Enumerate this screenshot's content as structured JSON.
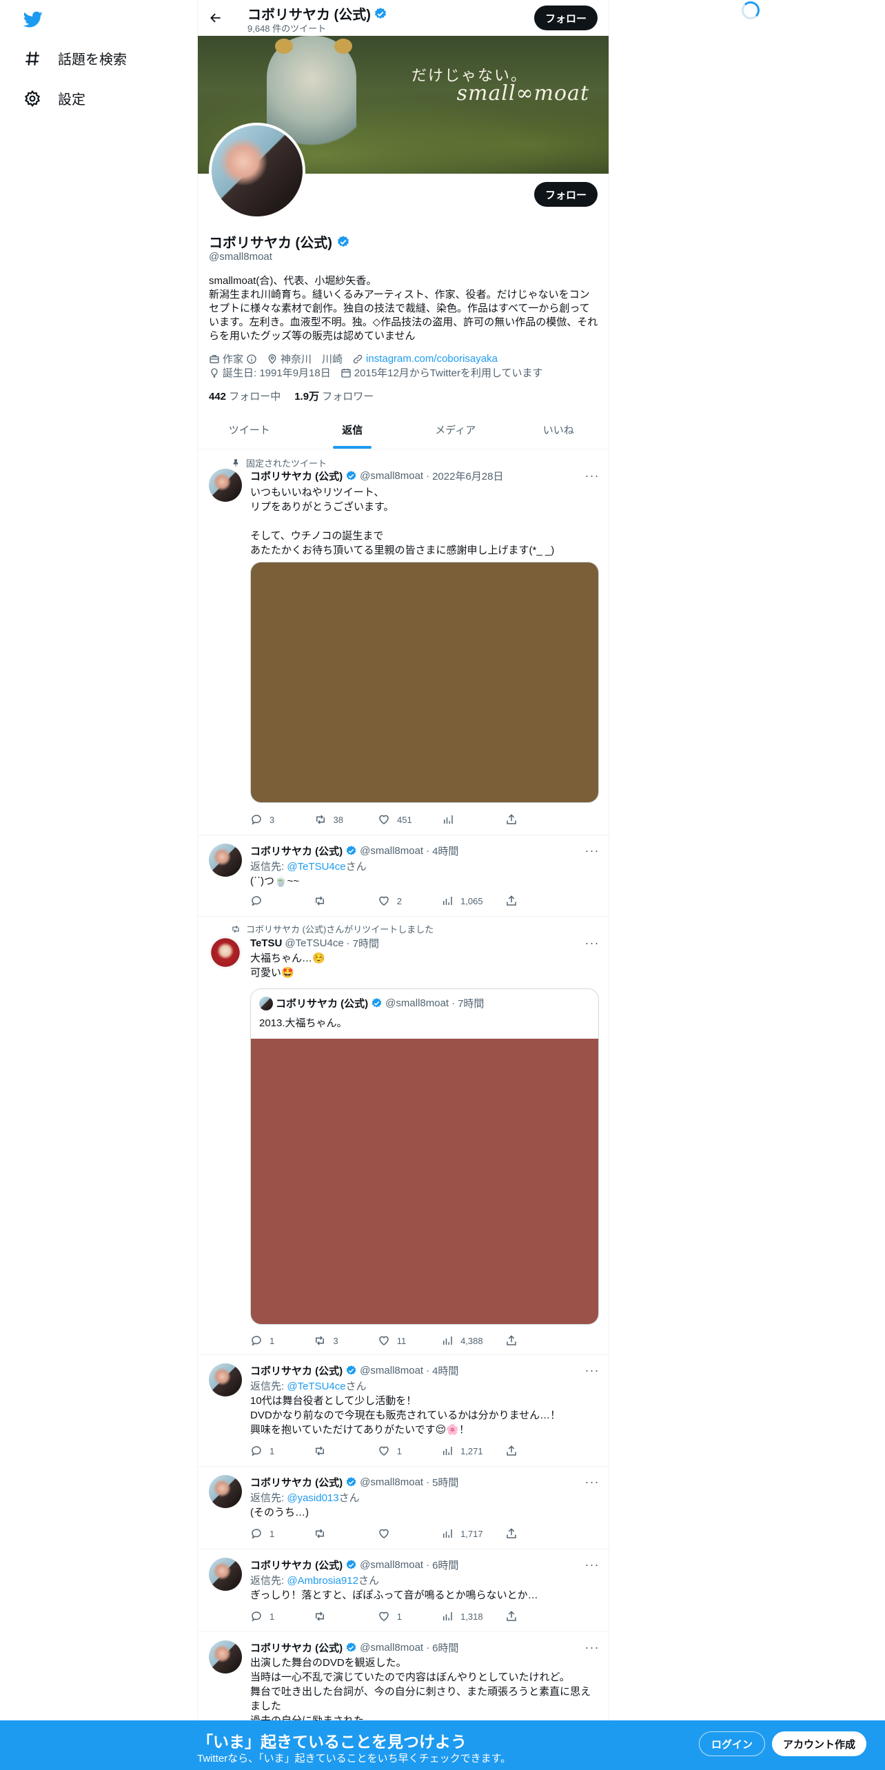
{
  "nav": {
    "explore_label": "話題を検索",
    "settings_label": "設定"
  },
  "header": {
    "name": "コボリサヤカ (公式)",
    "tweet_count": "9,648 件のツイート",
    "follow_label": "フォロー"
  },
  "banner": {
    "tagline": "だけじゃない。",
    "brand": "small∞moat"
  },
  "profile": {
    "name": "コボリサヤカ (公式)",
    "handle": "@small8moat",
    "follow_label": "フォロー",
    "bio": "smallmoat(合)、代表、小堀紗矢香。\n新潟生まれ川崎育ち。縫いくるみアーティスト、作家、役者。だけじゃないをコンセプトに様々な素材で創作。独自の技法で裁縫、染色。作品はすべて一から創っています。左利き。血液型不明。独。◇作品技法の盗用、許可の無い作品の模倣、それらを用いたグッズ等の販売は認めていません",
    "category": "作家",
    "location": "神奈川　川崎",
    "website": "instagram.com/coborisayaka",
    "birthday": "誕生日: 1991年9月18日",
    "joined": "2015年12月からTwitterを利用しています",
    "following_count": "442",
    "following_label": "フォロー中",
    "followers_count": "1.9万",
    "followers_label": "フォロワー"
  },
  "tabs": [
    "ツイート",
    "返信",
    "メディア",
    "いいね"
  ],
  "active_tab": "返信",
  "colors": {
    "accent": "#1d9bf0",
    "media1": "#7a5f38",
    "media2": "#9a5249"
  },
  "tweets": [
    {
      "context": "固定されたツイート",
      "name": "コボリサヤカ (公式)",
      "handle": "@small8moat",
      "time": "2022年6月28日",
      "text": "いつもいいねやリツイート、\nリプをありがとうございます。\n\nそして、ウチノコの誕生まで\nあたたかくお待ち頂いてる里親の皆さまに感謝申し上げます(*_ _)",
      "reply": "3",
      "retweet": "38",
      "like": "451",
      "views": ""
    },
    {
      "name": "コボリサヤカ (公式)",
      "handle": "@small8moat",
      "time": "4時間",
      "reply_prefix": "返信先: ",
      "reply_to": "@TeTSU4ce",
      "reply_suffix": "さん",
      "text": "(ˊˋ)つ🍵~~",
      "reply": "",
      "retweet": "",
      "like": "2",
      "views": "1,065"
    },
    {
      "context": "コボリサヤカ (公式)さんがリツイートしました",
      "name": "TeTSU",
      "handle": "@TeTSU4ce",
      "time": "7時間",
      "text": "大福ちゃん…☺️\n可愛い🤩",
      "quote_name": "コボリサヤカ (公式)",
      "quote_handle": "@small8moat",
      "quote_time": "7時間",
      "quote_text": "2013.大福ちゃん。",
      "reply": "1",
      "retweet": "3",
      "like": "11",
      "views": "4,388"
    },
    {
      "name": "コボリサヤカ (公式)",
      "handle": "@small8moat",
      "time": "4時間",
      "reply_prefix": "返信先: ",
      "reply_to": "@TeTSU4ce",
      "reply_suffix": "さん",
      "text": "10代は舞台役者として少し活動を！\nDVDかなり前なので今現在も販売されているかは分かりません…！\n興味を抱いていただけてありがたいです😌🌸！",
      "reply": "1",
      "retweet": "",
      "like": "1",
      "views": "1,271"
    },
    {
      "name": "コボリサヤカ (公式)",
      "handle": "@small8moat",
      "time": "5時間",
      "reply_prefix": "返信先: ",
      "reply_to": "@yasid013",
      "reply_suffix": "さん",
      "text": "(そのうち…)",
      "reply": "1",
      "retweet": "",
      "like": "",
      "views": "1,717"
    },
    {
      "name": "コボリサヤカ (公式)",
      "handle": "@small8moat",
      "time": "6時間",
      "reply_prefix": "返信先: ",
      "reply_to": "@Ambrosia912",
      "reply_suffix": "さん",
      "text": "ぎっしり！落とすと、ぽぽふって音が鳴るとか鳴らないとか…",
      "reply": "1",
      "retweet": "",
      "like": "1",
      "views": "1,318"
    },
    {
      "name": "コボリサヤカ (公式)",
      "handle": "@small8moat",
      "time": "6時間",
      "text": "出演した舞台のDVDを観返した。\n当時は一心不乱で演じていたので内容はぼんやりとしていたけれど。\n舞台で吐き出した台詞が、今の自分に刺さり、また頑張ろうと素直に思えました\n過去の自分に励まされた"
    }
  ],
  "bottom_bar": {
    "title": "「いま」起きていることを見つけよう",
    "subtitle": "Twitterなら、「いま」起きていることをいち早くチェックできます。",
    "login": "ログイン",
    "signup": "アカウント作成"
  }
}
